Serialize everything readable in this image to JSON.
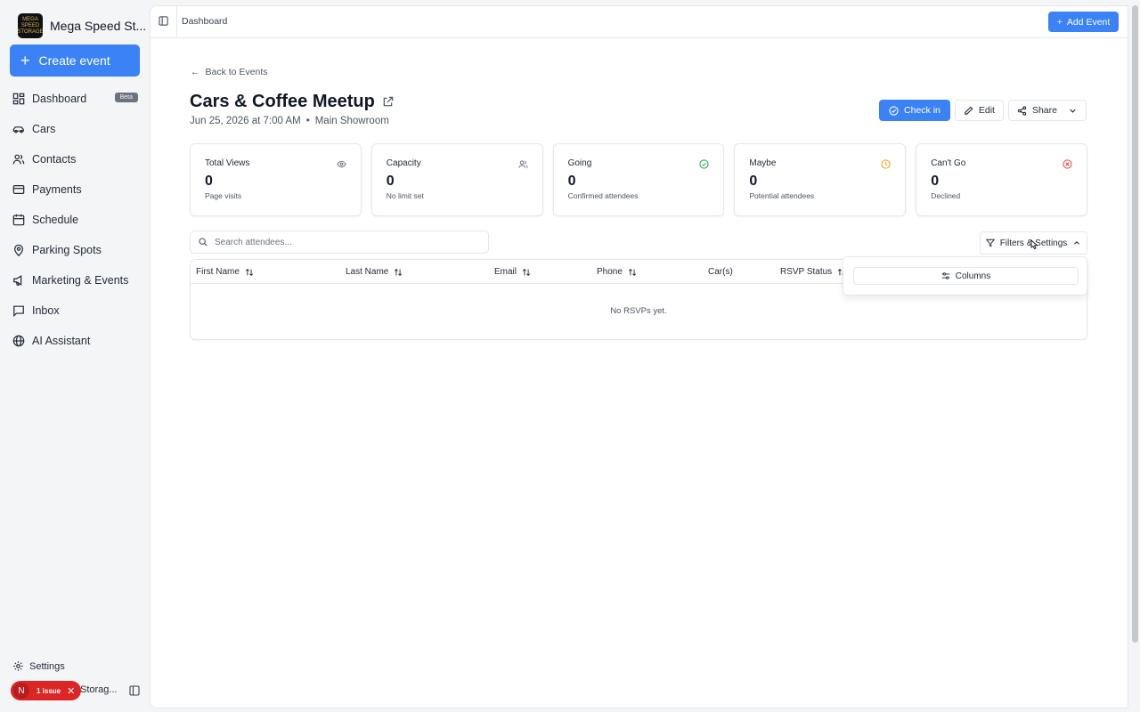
{
  "app": {
    "brand_name": "Mega Speed St...",
    "brand_logo_text": "MEGA SPEED STORAGE",
    "create_event_label": "Create event",
    "nav": [
      {
        "label": "Dashboard",
        "icon": "dashboard-icon",
        "badge": "Beta"
      },
      {
        "label": "Cars",
        "icon": "car-icon"
      },
      {
        "label": "Contacts",
        "icon": "contacts-icon"
      },
      {
        "label": "Payments",
        "icon": "credit-card-icon"
      },
      {
        "label": "Schedule",
        "icon": "calendar-icon"
      },
      {
        "label": "Parking Spots",
        "icon": "map-pin-icon"
      },
      {
        "label": "Marketing & Events",
        "icon": "megaphone-icon"
      },
      {
        "label": "Inbox",
        "icon": "message-icon"
      },
      {
        "label": "AI Assistant",
        "icon": "globe-icon"
      }
    ],
    "settings_label": "Settings",
    "issue_badge": {
      "initial": "N",
      "label": "1 issue"
    },
    "footer_org": "Storag..."
  },
  "topbar": {
    "breadcrumb": "Dashboard",
    "add_event_label": "Add Event"
  },
  "event": {
    "back_label": "Back to Events",
    "title": "Cars & Coffee Meetup",
    "date": "Jun 25, 2026 at 7:00 AM",
    "location": "Main Showroom",
    "actions": {
      "check_in": "Check in",
      "edit": "Edit",
      "share": "Share"
    }
  },
  "stats": [
    {
      "label": "Total Views",
      "value": "0",
      "sub": "Page visits",
      "icon": "eye-icon",
      "color": "#6b7280"
    },
    {
      "label": "Capacity",
      "value": "0",
      "sub": "No limit set",
      "icon": "users-icon",
      "color": "#6b7280"
    },
    {
      "label": "Going",
      "value": "0",
      "sub": "Confirmed attendees",
      "icon": "check-circle-icon",
      "color": "#16a34a"
    },
    {
      "label": "Maybe",
      "value": "0",
      "sub": "Potential attendees",
      "icon": "clock-icon",
      "color": "#f59e0b"
    },
    {
      "label": "Can't Go",
      "value": "0",
      "sub": "Declined",
      "icon": "x-circle-icon",
      "color": "#ef4444"
    }
  ],
  "attendees": {
    "search_placeholder": "Search attendees...",
    "filters_label": "Filters & Settings",
    "columns_label": "Columns",
    "headers": [
      "First Name",
      "Last Name",
      "Email",
      "Phone",
      "Car(s)",
      "RSVP Status"
    ],
    "empty_text": "No RSVPs yet."
  },
  "colors": {
    "accent": "#3b82f6",
    "issue": "#dc2626"
  }
}
